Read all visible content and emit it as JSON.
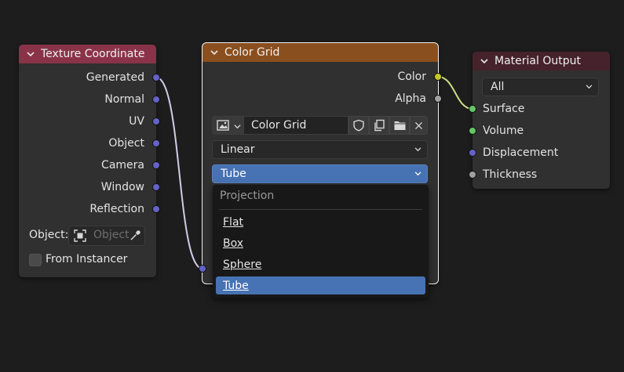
{
  "colors": {
    "background": "#1d1d1d",
    "node_body": "#303030",
    "texcoord_header": "#8a3348",
    "colorgrid_header": "#8a4f1f",
    "output_header": "#45222c",
    "socket_vector": "#6363c7",
    "socket_color": "#c7c729",
    "socket_float": "#a1a1a1",
    "socket_shader": "#63c763",
    "selection_highlight": "#4772b3",
    "wire": "#d2cbe8"
  },
  "texture_coordinate": {
    "title": "Texture Coordinate",
    "outputs": [
      "Generated",
      "Normal",
      "UV",
      "Object",
      "Camera",
      "Window",
      "Reflection"
    ],
    "object_label": "Object:",
    "object_placeholder": "Object",
    "from_instancer_label": "From Instancer",
    "from_instancer_checked": false
  },
  "color_grid": {
    "title": "Color Grid",
    "outputs": [
      {
        "label": "Color",
        "type": "color"
      },
      {
        "label": "Alpha",
        "type": "float"
      }
    ],
    "image_name": "Color Grid",
    "interpolation": "Linear",
    "projection": "Tube",
    "input_socket_type": "vector"
  },
  "projection_menu": {
    "title": "Projection",
    "items": [
      "Flat",
      "Box",
      "Sphere",
      "Tube"
    ],
    "active": "Tube"
  },
  "material_output": {
    "title": "Material Output",
    "target": "All",
    "inputs": [
      {
        "label": "Surface",
        "type": "shader"
      },
      {
        "label": "Volume",
        "type": "shader"
      },
      {
        "label": "Displacement",
        "type": "vector"
      },
      {
        "label": "Thickness",
        "type": "float"
      }
    ]
  },
  "links": [
    {
      "from": "Texture Coordinate.Generated",
      "to": "Color Grid.Vector"
    },
    {
      "from": "Color Grid.Color",
      "to": "Material Output.Surface"
    }
  ]
}
